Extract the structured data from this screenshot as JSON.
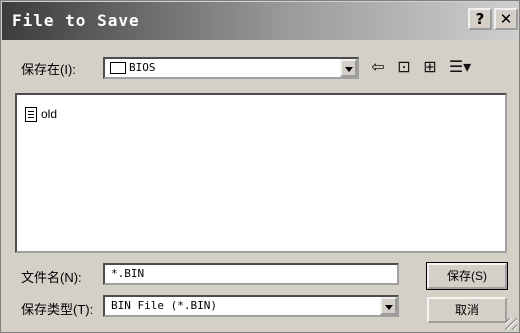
{
  "dialog": {
    "title": "File to Save",
    "help_glyph": "?",
    "close_glyph": "✕"
  },
  "save_in": {
    "label": "保存在(I):",
    "folder": "BIOS"
  },
  "toolbar": {
    "back_glyph": "⇦",
    "up_glyph": "⊡",
    "new_folder_glyph": "⊞",
    "view_glyph": "☰▾"
  },
  "files": [
    {
      "name": "old",
      "icon": "text-file-icon"
    }
  ],
  "filename": {
    "label": "文件名(N):",
    "value": "*.BIN"
  },
  "filetype": {
    "label": "保存类型(T):",
    "value": "BIN File (*.BIN)"
  },
  "buttons": {
    "save": "保存(S)",
    "cancel": "取消"
  }
}
